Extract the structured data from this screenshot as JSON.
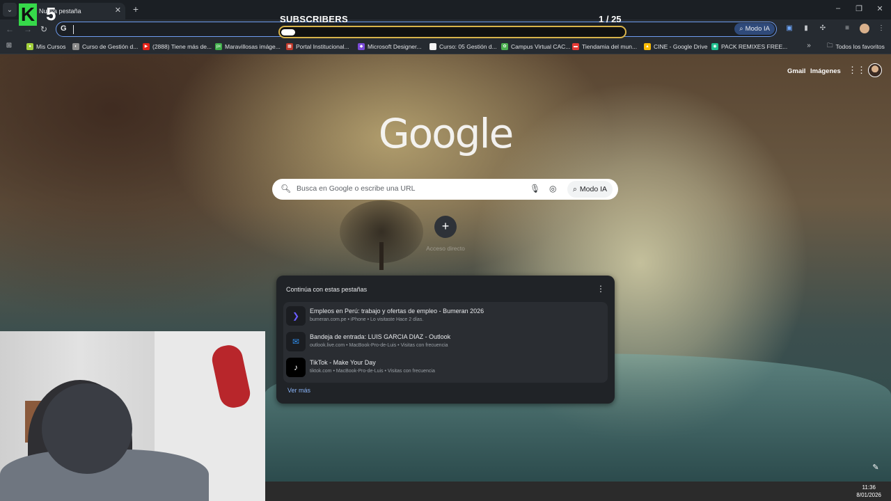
{
  "browser": {
    "tab_title": "Nueva pestaña",
    "modo_ia": "Modo IA",
    "bookmarks": [
      {
        "label": "Mis Cursos",
        "color": "#a3d13b"
      },
      {
        "label": "Curso de Gestión d...",
        "color": "#8c8c8c"
      },
      {
        "label": "(2888) Tiene más de...",
        "color": "#e62117"
      },
      {
        "label": "Maravillosas imáge...",
        "color": "#3fae49"
      },
      {
        "label": "Portal Institucional...",
        "color": "#c0392b"
      },
      {
        "label": "Microsoft Designer...",
        "color": "#7b4ad9"
      },
      {
        "label": "Curso: 05 Gestión d...",
        "color": "#f2f2f2"
      },
      {
        "label": "Campus Virtual CAC...",
        "color": "#4caf50"
      },
      {
        "label": "Tiendamia del mun...",
        "color": "#e53935"
      },
      {
        "label": "CINE - Google Drive",
        "color": "#fbbc04"
      },
      {
        "label": "PACK REMIXES FREE...",
        "color": "#1fbf8f"
      }
    ],
    "all_bookmarks": "Todos los favoritos"
  },
  "ntp": {
    "gmail": "Gmail",
    "images": "Imágenes",
    "logo": "Google",
    "search_placeholder": "Busca en Google o escribe una URL",
    "modo_ia": "Modo IA",
    "shortcut_label": "Acceso directo",
    "continue_title": "Continúa con estas pestañas",
    "continue_items": [
      {
        "title": "Empleos en Perú: trabajo y ofertas de empleo - Bumeran 2026",
        "sub": "bumeran.com.pe • iPhone • Lo visitaste Hace 2 días."
      },
      {
        "title": "Bandeja de entrada: LUIS GARCIA DIAZ - Outlook",
        "sub": "outlook.live.com • MacBook-Pro-de-Luis • Visitas con frecuencia"
      },
      {
        "title": "TikTok - Make Your Day",
        "sub": "tiktok.com • MacBook-Pro-de-Luis • Visitas con frecuencia"
      }
    ],
    "see_more": "Ver más"
  },
  "overlay": {
    "logo_letter": "K",
    "logo_number": "5",
    "subscribers_label": "SUBSCRIBERS",
    "subscribers_count": "1 / 25",
    "progress_fraction": 0.04
  },
  "taskbar": {
    "time": "11:36",
    "date": "8/01/2026"
  }
}
